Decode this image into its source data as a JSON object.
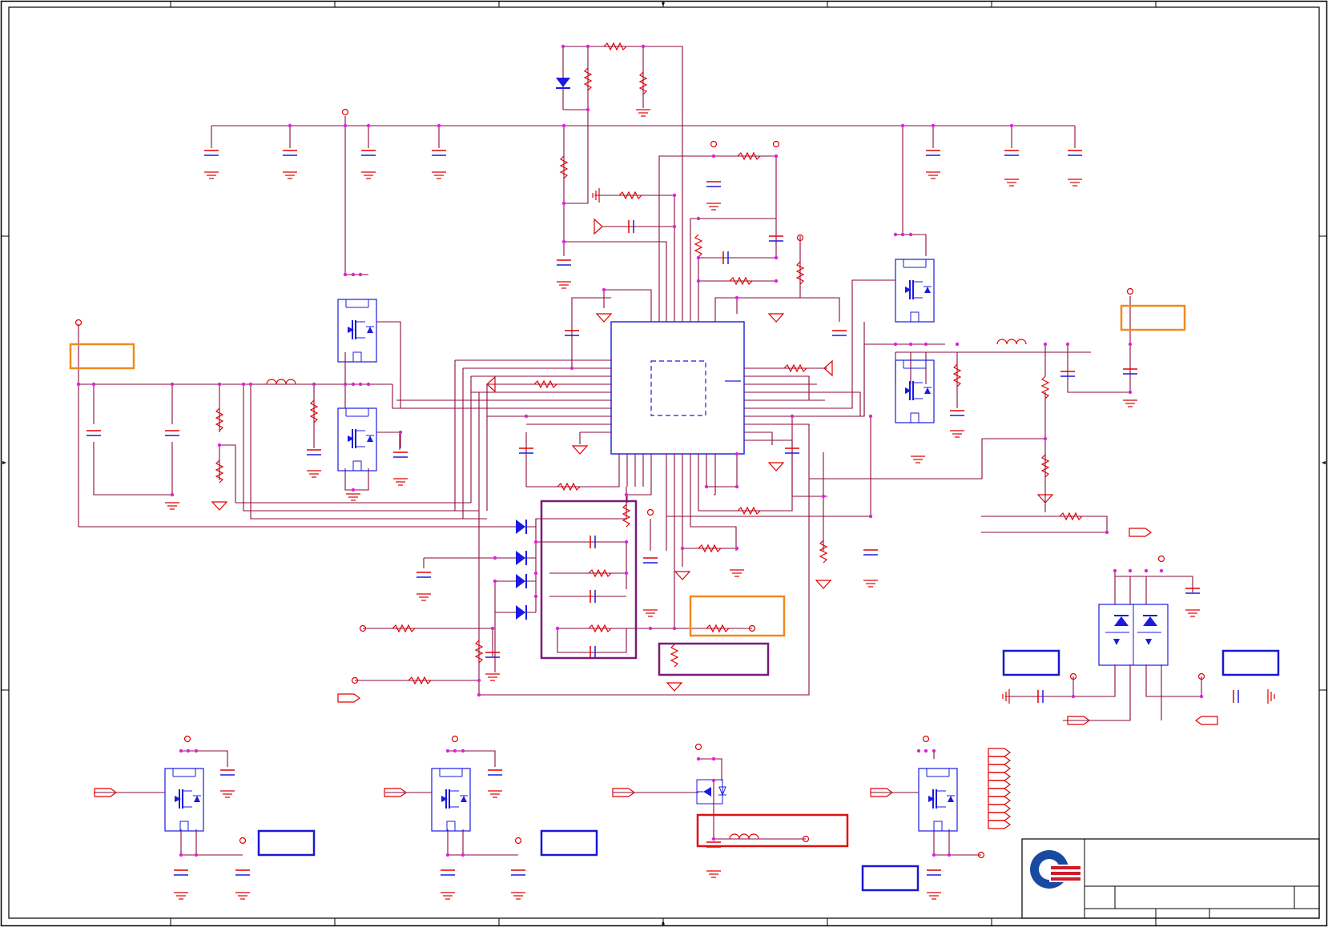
{
  "diagram": {
    "kind": "electrical-schematic",
    "colors": {
      "wire": "#8b0a3c",
      "component": "#e00000",
      "ic_outline": "#1a1ae0",
      "junction": "#e020e0",
      "highlight_orange": "#f08a1e",
      "highlight_purple": "#7a1a7a",
      "highlight_blue": "#1818d0",
      "highlight_red": "#e01010",
      "frame": "#000000",
      "logo_blue": "#1a4aa0",
      "logo_red": "#d01a2a"
    },
    "title_block": {
      "logo": "company-logo"
    }
  }
}
